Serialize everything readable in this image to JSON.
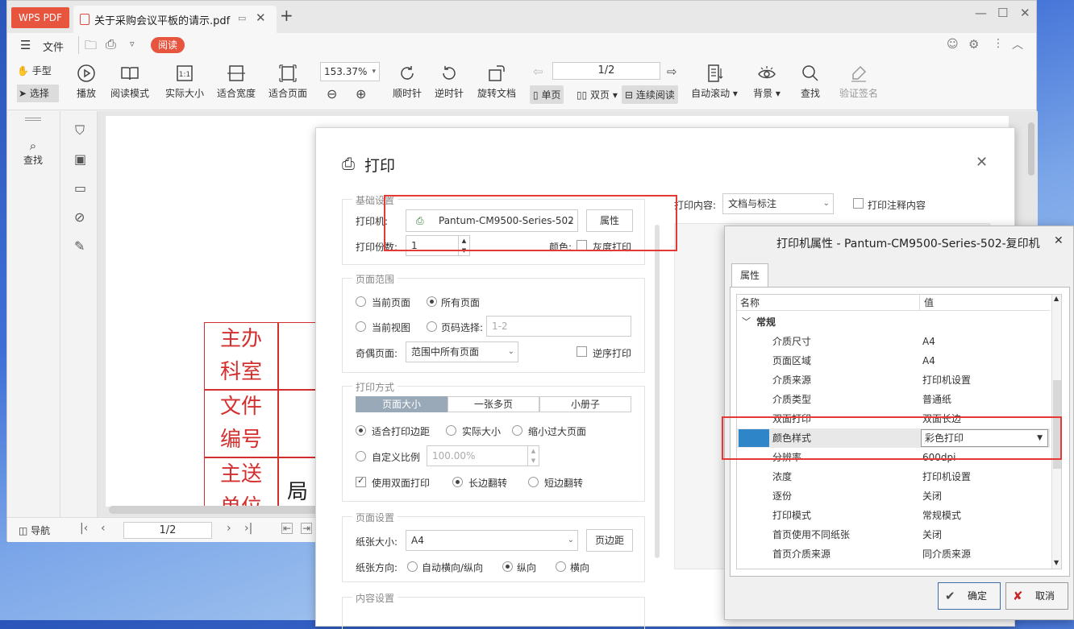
{
  "app": {
    "logo": "WPS PDF",
    "tab_title": "关于采购会议平板的请示.pdf"
  },
  "menu": {
    "file": "文件",
    "read_badge": "阅读"
  },
  "toolbar": {
    "hand": "手型",
    "select": "选择",
    "play": "播放",
    "read_mode": "阅读模式",
    "actual_size": "实际大小",
    "fit_width": "适合宽度",
    "fit_page": "适合页面",
    "zoom": "153.37%",
    "rotate_cw": "顺时针",
    "rotate_ccw": "逆时针",
    "rotate_doc": "旋转文档",
    "page_input": "1/2",
    "single_page": "单页",
    "double_page": "双页",
    "continuous": "连续阅读",
    "auto_scroll": "自动滚动",
    "background": "背景",
    "find": "查找",
    "verify_sign": "验证签名"
  },
  "left_panel": {
    "find": "查找"
  },
  "document": {
    "cells": [
      "主办\n科室",
      "文件\n编号",
      "主送\n单位"
    ],
    "partial": "局领"
  },
  "statusbar": {
    "nav": "导航",
    "page": "1/2"
  },
  "print_dialog": {
    "title": "打印",
    "basic": {
      "title": "基础设置",
      "printer_label": "打印机:",
      "printer": "Pantum-CM9500-Series-502",
      "props_btn": "属性",
      "copies_label": "打印份数:",
      "copies": "1",
      "color_label": "颜色:",
      "grayscale": "灰度打印"
    },
    "content_label": "打印内容:",
    "content_value": "文档与标注",
    "print_comments": "打印注释内容",
    "range": {
      "title": "页面范围",
      "current_page": "当前页面",
      "all_pages": "所有页面",
      "current_view": "当前视图",
      "page_select": "页码选择:",
      "page_select_placeholder": "1-2",
      "odd_even_label": "奇偶页面:",
      "odd_even": "范围中所有页面",
      "reverse": "逆序打印"
    },
    "method": {
      "title": "打印方式",
      "tabs": [
        "页面大小",
        "一张多页",
        "小册子"
      ],
      "fit_margin": "适合打印边距",
      "actual": "实际大小",
      "shrink": "缩小过大页面",
      "custom_scale": "自定义比例",
      "scale": "100.00%",
      "duplex": "使用双面打印",
      "long_edge": "长边翻转",
      "short_edge": "短边翻转"
    },
    "page_setup": {
      "title": "页面设置",
      "paper_label": "纸张大小:",
      "paper": "A4",
      "margins_btn": "页边距",
      "orient_label": "纸张方向:",
      "auto": "自动横向/纵向",
      "portrait": "纵向",
      "landscape": "横向"
    },
    "content_settings": "内容设置"
  },
  "printer_props": {
    "title": "打印机属性 - Pantum-CM9500-Series-502-复印机",
    "tab": "属性",
    "col_name": "名称",
    "col_value": "值",
    "group": "常规",
    "rows": [
      {
        "n": "介质尺寸",
        "v": "A4"
      },
      {
        "n": "页面区域",
        "v": "A4"
      },
      {
        "n": "介质来源",
        "v": "打印机设置"
      },
      {
        "n": "介质类型",
        "v": "普通纸"
      },
      {
        "n": "双面打印",
        "v": "双面长边"
      },
      {
        "n": "颜色样式",
        "v": "彩色打印"
      },
      {
        "n": "分辨率",
        "v": "600dpi"
      },
      {
        "n": "浓度",
        "v": "打印机设置"
      },
      {
        "n": "逐份",
        "v": "关闭"
      },
      {
        "n": "打印模式",
        "v": "常规模式"
      },
      {
        "n": "首页使用不同纸张",
        "v": "关闭"
      },
      {
        "n": "首页介质来源",
        "v": "同介质来源"
      }
    ],
    "ok": "确定",
    "cancel": "取消"
  }
}
